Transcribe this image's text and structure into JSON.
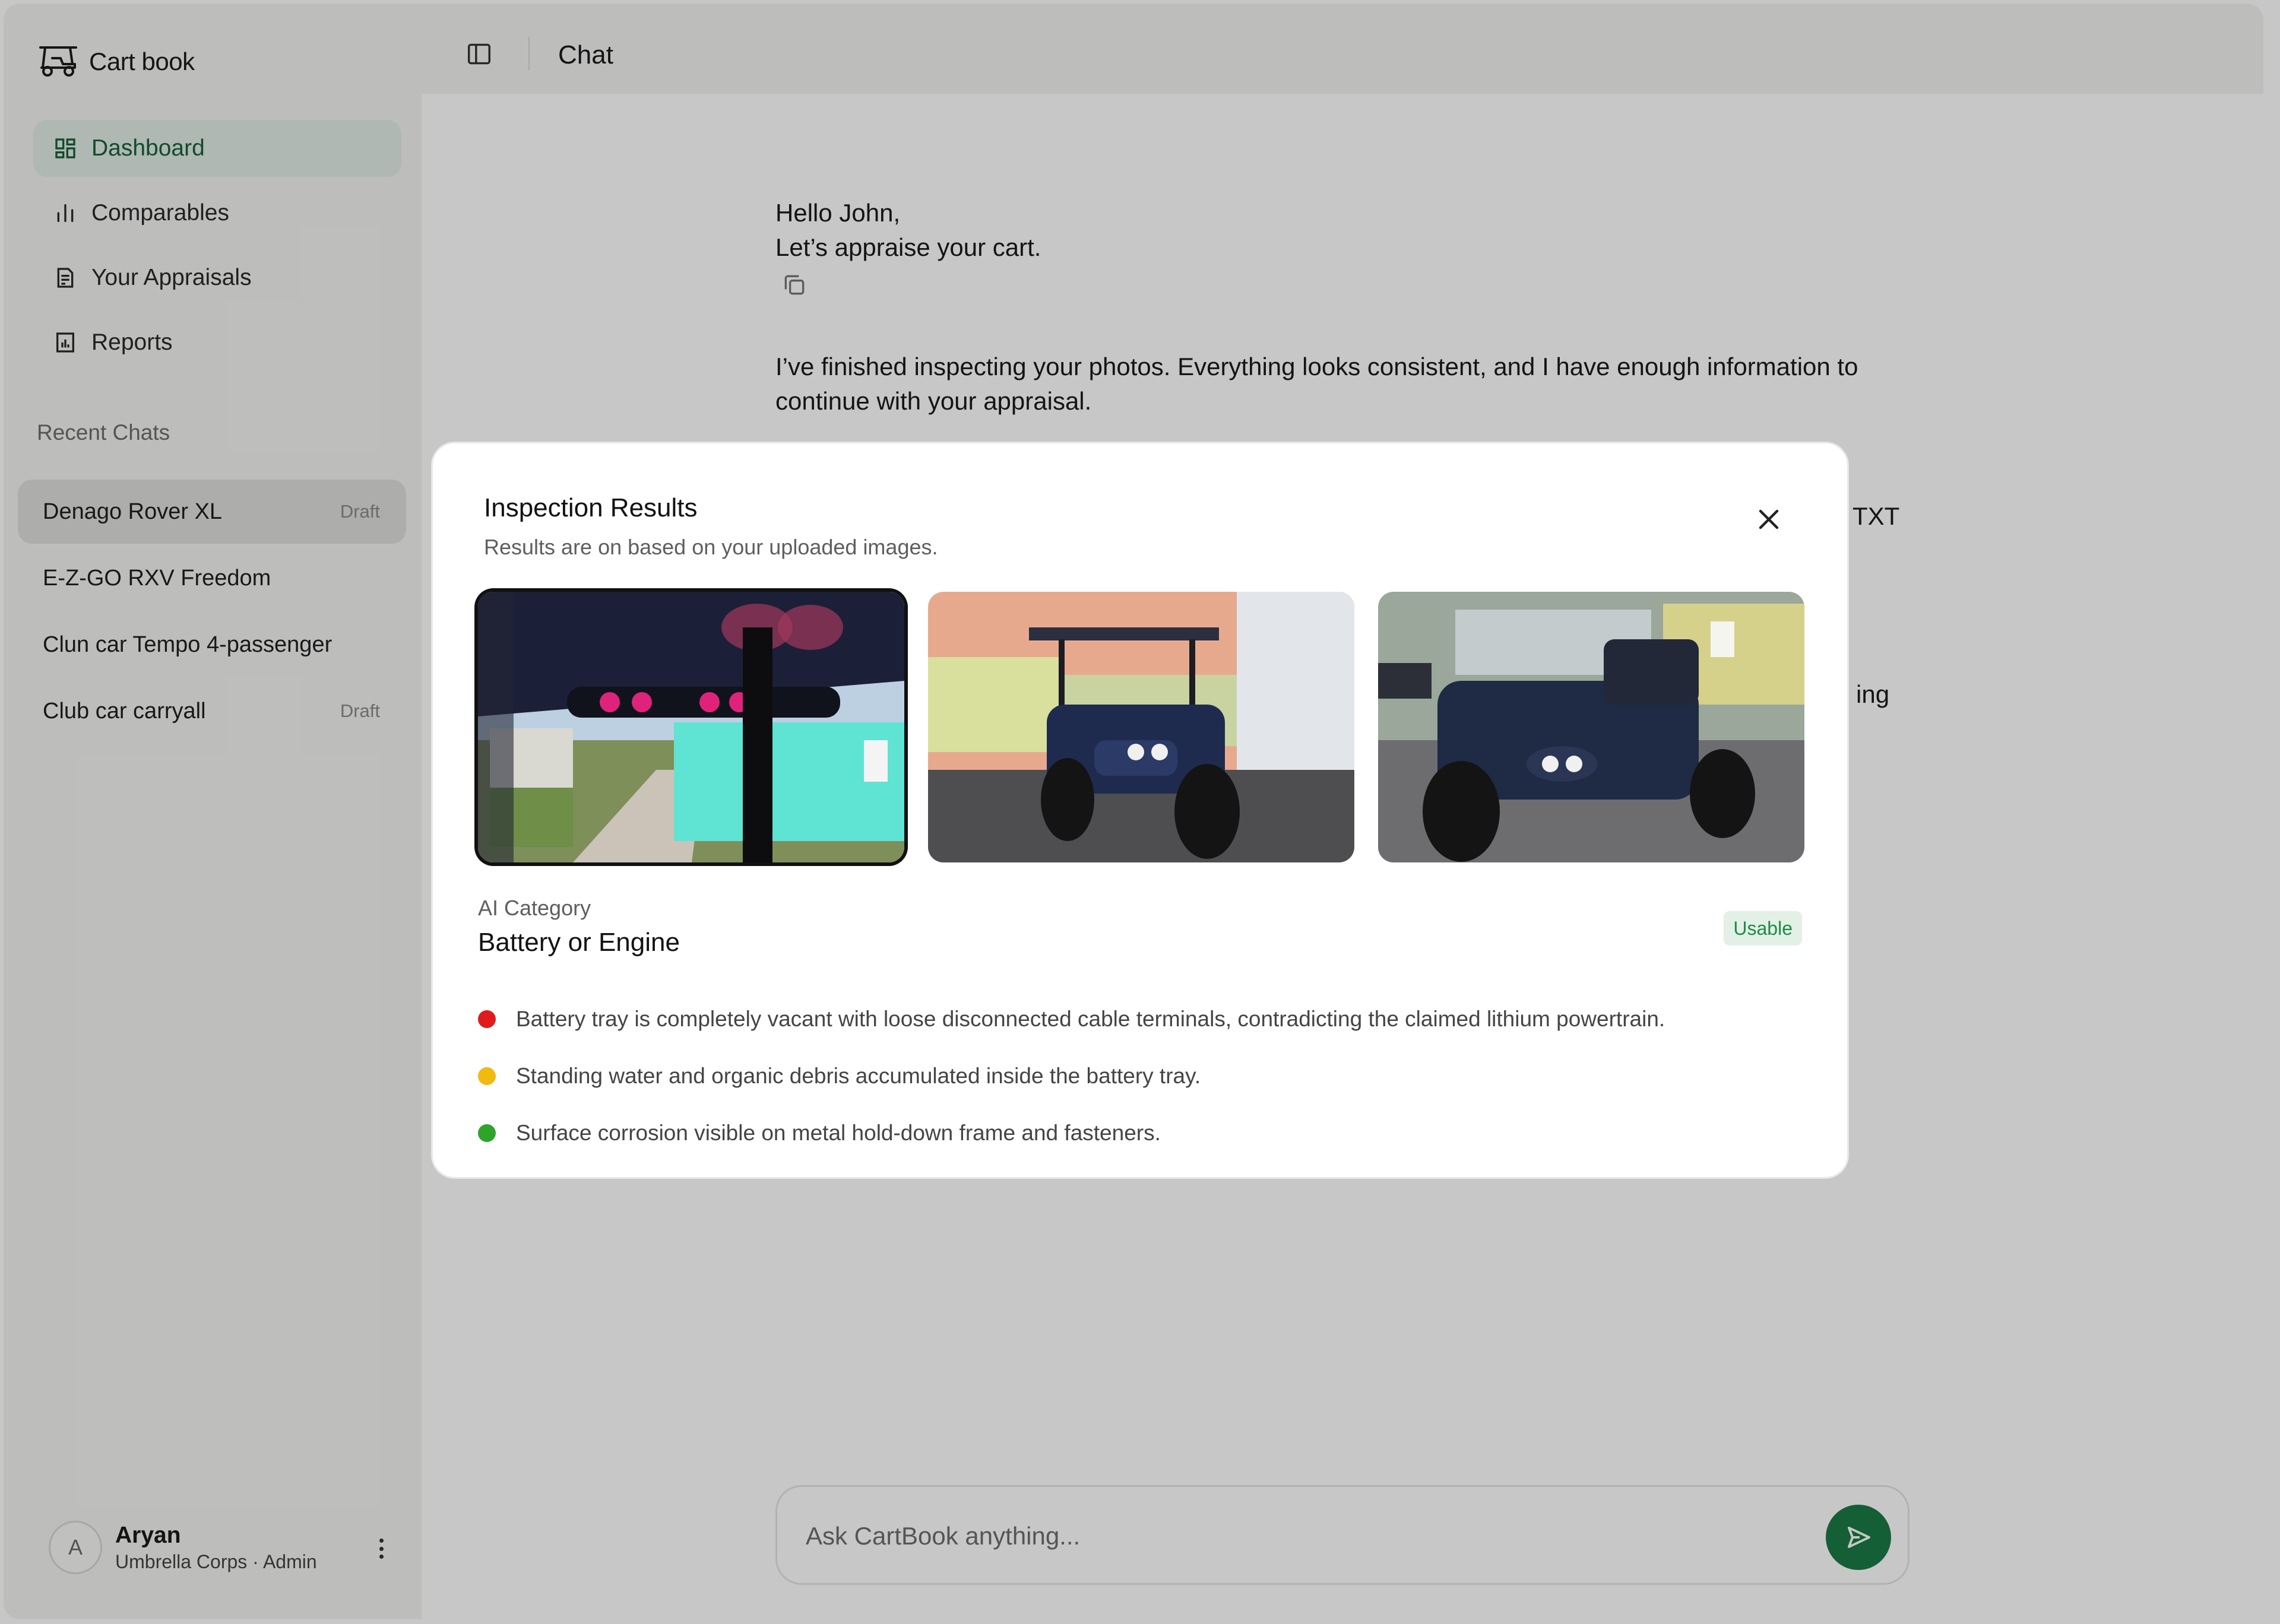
{
  "app": {
    "brand": "Cart book"
  },
  "sidebar": {
    "nav": [
      {
        "label": "Dashboard",
        "icon": "dashboard-icon",
        "active": true
      },
      {
        "label": "Comparables",
        "icon": "bar-chart-icon"
      },
      {
        "label": "Your Appraisals",
        "icon": "document-list-icon"
      },
      {
        "label": "Reports",
        "icon": "report-icon"
      }
    ],
    "recent_label": "Recent Chats",
    "recent_chats": [
      {
        "title": "Denago Rover XL",
        "status": "Draft",
        "active": true
      },
      {
        "title": "E-Z-GO RXV Freedom",
        "status": ""
      },
      {
        "title": "Clun car Tempo 4-passenger",
        "status": ""
      },
      {
        "title": "Club car carryall",
        "status": "Draft"
      }
    ],
    "user": {
      "initial": "A",
      "name": "Aryan",
      "org_role": "Umbrella Corps · Admin"
    }
  },
  "header": {
    "title": "Chat"
  },
  "chat": {
    "greeting_line1": "Hello John,",
    "greeting_line2": "Let’s appraise your cart.",
    "message": "I’ve finished inspecting your photos. Everything looks consistent, and I have enough information to continue with your appraisal.",
    "partial_1": "TXT",
    "partial_2": "ing"
  },
  "composer": {
    "placeholder": "Ask CartBook anything..."
  },
  "modal": {
    "title": "Inspection Results",
    "subtitle": "Results are on based on your uploaded images.",
    "images": [
      {
        "name": "canopy-light-bar-photo",
        "selected": true
      },
      {
        "name": "cart-front-driveway-photo",
        "selected": false
      },
      {
        "name": "cart-front-left-photo",
        "selected": false
      }
    ],
    "ai_category_label": "AI Category",
    "ai_category_value": "Battery or Engine",
    "badge": "Usable",
    "findings": [
      {
        "severity": "high",
        "color": "#e01b1b",
        "text": "Battery tray is completely vacant with loose disconnected cable terminals, contradicting the claimed lithium powertrain."
      },
      {
        "severity": "medium",
        "color": "#f2b90f",
        "text": "Standing water and organic debris accumulated inside the battery tray."
      },
      {
        "severity": "low",
        "color": "#2ea52a",
        "text": "Surface corrosion visible on metal hold-down frame and fasteners."
      }
    ]
  },
  "colors": {
    "accent": "#1a7a44",
    "active_nav_bg": "#e0ece4",
    "active_nav_text": "#17613a",
    "badge_bg": "#e2f0e6",
    "badge_text": "#1f8a47"
  }
}
